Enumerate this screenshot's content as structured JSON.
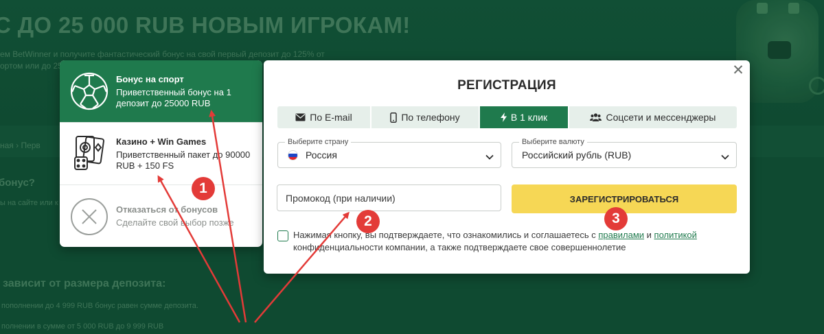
{
  "background": {
    "title": "С ДО 25 000 RUB НОВЫМ ИГРОКАМ!",
    "subtitle_1": "ем BetWinner и получите фантастический бонус на свой первый депозит до 125% от",
    "subtitle_2": "ортом или до 25",
    "breadcrumb": "ная  ›  Перв",
    "question": "бонус?",
    "line": "ы на сайте или к",
    "heading_2": "зависит от размера депозита:",
    "line_2": "пополнении до 4 999 RUB бонус равен сумме депозита.",
    "line_3": "полнении в сумме от 5 000 RUB до 9 999 RUB"
  },
  "bonus_panel": {
    "items": [
      {
        "icon": "soccer-ball-icon",
        "title": "Бонус на спорт",
        "description": "Приветственный бонус на 1 депозит до 25000 RUB",
        "state": "active"
      },
      {
        "icon": "casino-cards-dice-icon",
        "title": "Казино + Win Games",
        "description": "Приветственный пакет до 90000 RUB + 150 FS",
        "state": "normal"
      },
      {
        "icon": "decline-x-icon",
        "title": "Отказаться от бонусов",
        "description": "Сделайте свой выбор позже",
        "state": "muted"
      }
    ]
  },
  "registration": {
    "title": "РЕГИСТРАЦИЯ",
    "close_icon": "close-icon",
    "tabs": [
      {
        "label": "По E-mail",
        "icon": "envelope-icon"
      },
      {
        "label": "По телефону",
        "icon": "phone-icon"
      },
      {
        "label": "В 1 клик",
        "icon": "lightning-icon",
        "active": true
      },
      {
        "label": "Соцсети и мессенджеры",
        "icon": "users-icon"
      }
    ],
    "country": {
      "label": "Выберите страну",
      "value": "Россия"
    },
    "currency": {
      "label": "Выберите валюту",
      "value": "Российский рубль (RUB)"
    },
    "promo": {
      "placeholder": "Промокод (при наличии)",
      "value": ""
    },
    "register_button": "ЗАРЕГИСТРИРОВАТЬСЯ",
    "consent": {
      "before": "Нажимая кнопку, вы подтверждаете, что ознакомились и соглашаетесь с ",
      "rules_link": "правилами",
      "middle": " и ",
      "policy_link": "политикой",
      "after": " конфиденциальности компании, а также подтверждаете свое совершеннолетие"
    }
  },
  "annotations": {
    "badges": [
      "1",
      "2",
      "3"
    ],
    "badge_color": "#e33b38",
    "arrow_color": "#e33b38"
  },
  "colors": {
    "brand_green": "#1f7a4d",
    "button_yellow": "#f6d755",
    "overlay_background": "#0f4a31"
  }
}
